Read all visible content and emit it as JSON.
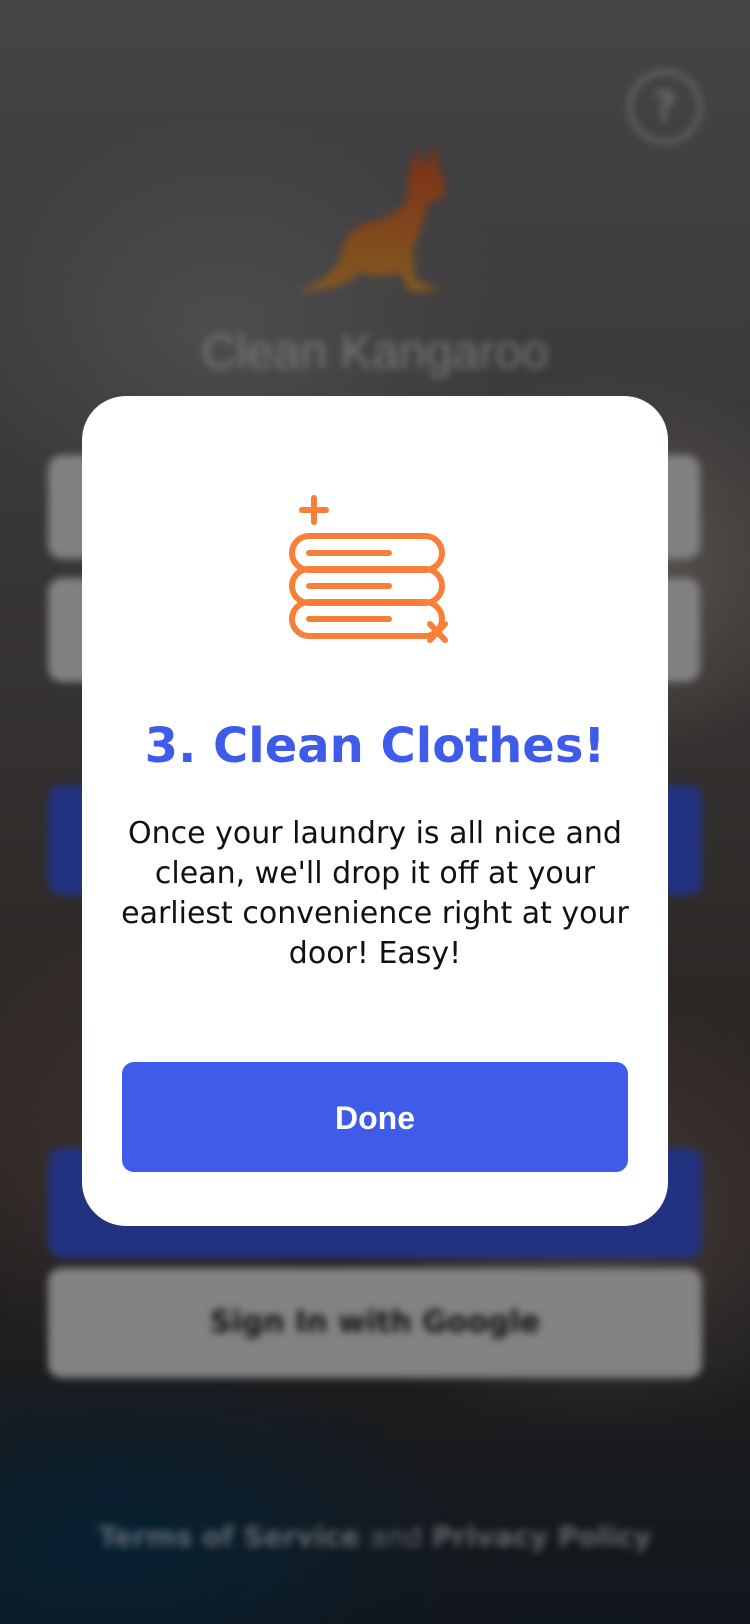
{
  "background": {
    "brand_name": "Clean Kangaroo",
    "google_button_label": "Sign In with Google",
    "legal": {
      "terms": "Terms of Service",
      "and": "and",
      "privacy": "Privacy Policy"
    },
    "accent_color": "#3e5ce9"
  },
  "modal": {
    "icon": "folded-towels-icon",
    "icon_color": "#f77f3a",
    "title": "3. Clean Clothes!",
    "body": "Once your laundry is all nice and clean, we'll drop it off at your earliest convenience right at your door! Easy!",
    "done_label": "Done"
  }
}
